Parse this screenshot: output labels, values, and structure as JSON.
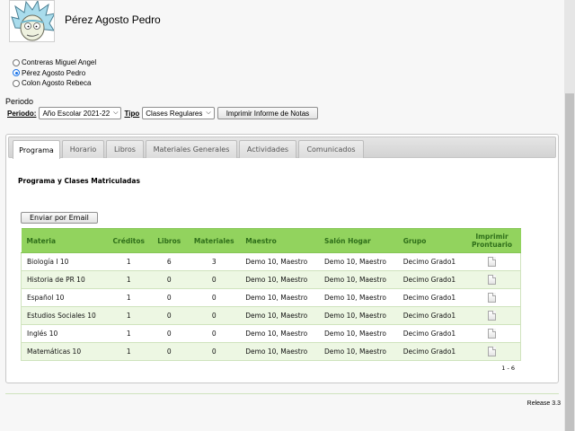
{
  "student": {
    "name": "Pérez Agosto Pedro"
  },
  "students": [
    {
      "name": "Contreras Miguel Angel",
      "selected": false
    },
    {
      "name": "Pérez Agosto Pedro",
      "selected": true
    },
    {
      "name": "Colon Agosto Rebeca",
      "selected": false
    }
  ],
  "periodo_title": "Periodo",
  "filters": {
    "periodo_label": "Periodo:",
    "periodo_value": "Año Escolar 2021-22",
    "tipo_label": "Tipo",
    "tipo_value": "Clases Regulares",
    "print_button": "Imprimir Informe de Notas"
  },
  "tabs": [
    "Programa",
    "Horario",
    "Libros",
    "Materiales Generales",
    "Actividades",
    "Comunicados"
  ],
  "active_tab": "Programa",
  "section_title": "Programa y Clases Matriculadas",
  "email_button": "Enviar por Email",
  "table": {
    "headers": [
      "Materia",
      "Créditos",
      "Libros",
      "Materiales",
      "Maestro",
      "Salón Hogar",
      "Grupo",
      "Imprimir Prontuario"
    ],
    "rows": [
      [
        "Biología I 10",
        "1",
        "6",
        "3",
        "Demo 10, Maestro",
        "Demo 10, Maestro",
        "Decimo Grado1"
      ],
      [
        "Historia de PR 10",
        "1",
        "0",
        "0",
        "Demo 10, Maestro",
        "Demo 10, Maestro",
        "Decimo Grado1"
      ],
      [
        "Español 10",
        "1",
        "0",
        "0",
        "Demo 10, Maestro",
        "Demo 10, Maestro",
        "Decimo Grado1"
      ],
      [
        "Estudios Sociales 10",
        "1",
        "0",
        "0",
        "Demo 10, Maestro",
        "Demo 10, Maestro",
        "Decimo Grado1"
      ],
      [
        "Inglés 10",
        "1",
        "0",
        "0",
        "Demo 10, Maestro",
        "Demo 10, Maestro",
        "Decimo Grado1"
      ],
      [
        "Matemáticas 10",
        "1",
        "0",
        "0",
        "Demo 10, Maestro",
        "Demo 10, Maestro",
        "Decimo Grado1"
      ]
    ]
  },
  "pager": "1 - 6",
  "release": "Release 3.3",
  "icons": {
    "print_syllabus": "document-icon",
    "avatar": "rick-avatar"
  },
  "colors": {
    "table_header": "#92d35e",
    "table_header_text": "#2f6f1a",
    "row_alt": "#edf7e3",
    "radio_selected": "#1a73e8"
  }
}
